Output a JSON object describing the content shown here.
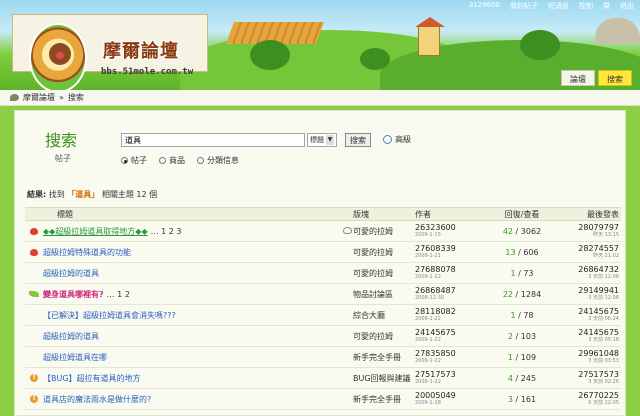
{
  "header": {
    "logo_title": "摩爾論壇",
    "logo_url": "bbs.51mole.com.tw",
    "topnav": [
      "3129600",
      "我的帖子",
      "短消息",
      "控制",
      "幫",
      "退出"
    ],
    "tabs": [
      {
        "label": "論壇",
        "active": false
      },
      {
        "label": "搜索",
        "active": true
      }
    ]
  },
  "breadcrumb": {
    "home": "摩爾論壇",
    "sep": "»",
    "current": "搜索"
  },
  "search": {
    "title": "搜索",
    "subtitle": "帖子",
    "query": "道具",
    "select_value": "標題",
    "button": "搜索",
    "advanced": "高級",
    "radios": [
      {
        "label": "帖子",
        "checked": true
      },
      {
        "label": "商品",
        "checked": false
      },
      {
        "label": "分類信息",
        "checked": false
      }
    ]
  },
  "result": {
    "prefix": "結果:",
    "found": "找到",
    "keyword": "「道具」",
    "suffix": "相關主題 12 個"
  },
  "table": {
    "headers": {
      "title": "標題",
      "forum": "版塊",
      "author": "作者",
      "replies": "回復/查看",
      "last": "最後發表"
    },
    "rows": [
      {
        "icon": "heart",
        "title": "◆◆超級拉姆道具取得地方◆◆",
        "style": "green",
        "pages": "… 1 2 3",
        "forum": "可愛的拉姆",
        "author": "26323600",
        "date": "2009-1-15",
        "replies": "42",
        "views": "3062",
        "last_author": "28079797",
        "last_time": "昨天 13:15"
      },
      {
        "icon": "heart",
        "title": "超級拉姆特殊道具的功能",
        "style": "normal",
        "pages": "",
        "forum": "可愛的拉姆",
        "author": "27608339",
        "date": "2009-1-21",
        "replies": "13",
        "views": "606",
        "last_author": "28274557",
        "last_time": "昨天 21:02"
      },
      {
        "icon": "",
        "title": "超級拉姆的道具",
        "style": "normal",
        "pages": "",
        "forum": "可愛的拉姆",
        "author": "27688078",
        "date": "2009-1-22",
        "replies": "1",
        "views": "73",
        "last_author": "26864732",
        "last_time": "3 天前 12:06"
      },
      {
        "icon": "leaf",
        "title": "變身道具哪裡有?",
        "style": "pink",
        "pages": "… 1 2",
        "forum": "物品討論區",
        "author": "26868487",
        "date": "2008-12-30",
        "replies": "22",
        "views": "1284",
        "last_author": "29149941",
        "last_time": "3 天前 12:06"
      },
      {
        "icon": "",
        "title": "【已解決】超級拉姆道具會消失嗎???",
        "style": "normal",
        "pages": "",
        "forum": "綜合大廳",
        "author": "28118082",
        "date": "2009-1-22",
        "replies": "1",
        "views": "78",
        "last_author": "24145675",
        "last_time": "3 天前 06:24"
      },
      {
        "icon": "",
        "title": "超級拉姆的道具",
        "style": "normal",
        "pages": "",
        "forum": "可愛的拉姆",
        "author": "24145675",
        "date": "2009-1-22",
        "replies": "2",
        "views": "103",
        "last_author": "24145675",
        "last_time": "3 天前 05:18"
      },
      {
        "icon": "",
        "title": "超級拉姆道具在哪",
        "style": "normal",
        "pages": "",
        "forum": "新手完全手冊",
        "author": "27835850",
        "date": "2009-1-22",
        "replies": "1",
        "views": "109",
        "last_author": "29961048",
        "last_time": "3 天前 03:53"
      },
      {
        "icon": "oball",
        "title": "【BUG】超拉有道具的地方",
        "style": "normal",
        "pages": "",
        "forum": "BUG回報與建議",
        "author": "27517573",
        "date": "2009-1-22",
        "replies": "4",
        "views": "245",
        "last_author": "27517573",
        "last_time": "3 天前 02:26"
      },
      {
        "icon": "oball",
        "title": "道具店的魔法雨水是做什麼的?",
        "style": "normal",
        "pages": "",
        "forum": "新手完全手冊",
        "author": "20005049",
        "date": "2009-1-18",
        "replies": "3",
        "views": "161",
        "last_author": "26770225",
        "last_time": "5 天前 22:05"
      }
    ]
  }
}
